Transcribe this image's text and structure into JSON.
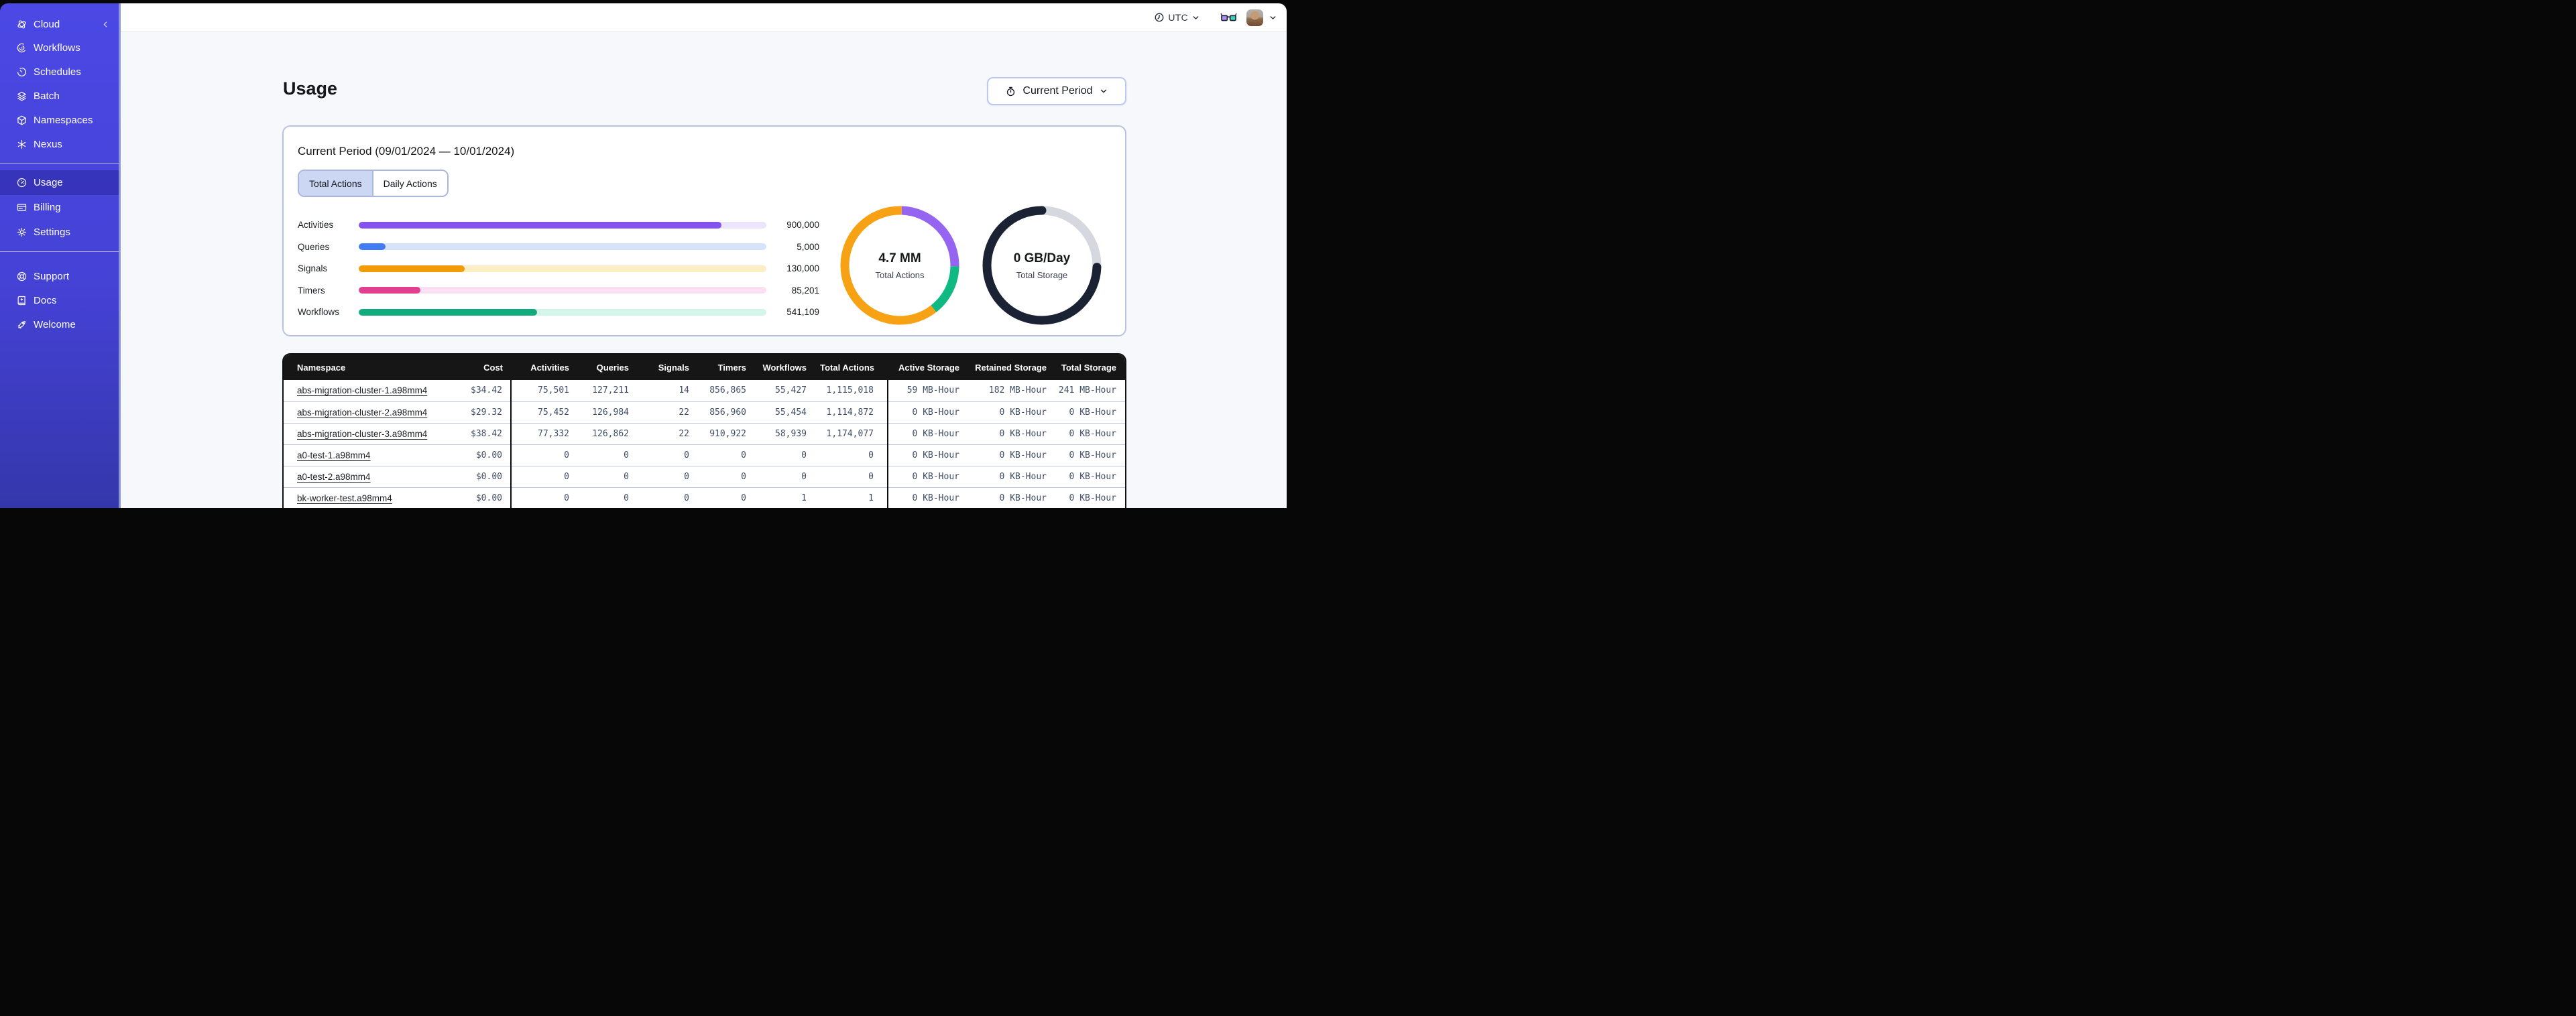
{
  "sidebar": {
    "brand": {
      "label": "Cloud"
    },
    "nav_main": [
      {
        "label": "Workflows"
      },
      {
        "label": "Schedules"
      },
      {
        "label": "Batch"
      },
      {
        "label": "Namespaces"
      },
      {
        "label": "Nexus"
      }
    ],
    "nav_account": [
      {
        "label": "Usage",
        "active": true
      },
      {
        "label": "Billing",
        "active": false
      },
      {
        "label": "Settings",
        "active": false
      }
    ],
    "nav_footer": [
      {
        "label": "Support"
      },
      {
        "label": "Docs"
      },
      {
        "label": "Welcome"
      }
    ]
  },
  "topbar": {
    "timezone": "UTC"
  },
  "page": {
    "title": "Usage",
    "period_selector_label": "Current Period"
  },
  "panel": {
    "title": "Current Period (09/01/2024 — 10/01/2024)",
    "tabs": [
      {
        "label": "Total Actions",
        "active": true
      },
      {
        "label": "Daily Actions",
        "active": false
      }
    ]
  },
  "chart_data": [
    {
      "type": "bar",
      "title": "Actions by type (current period)",
      "categories": [
        "Activities",
        "Queries",
        "Signals",
        "Timers",
        "Workflows"
      ],
      "values": [
        900000,
        5000,
        130000,
        85201,
        541109
      ],
      "value_labels": [
        "900,000",
        "5,000",
        "130,000",
        "85,201",
        "541,109"
      ],
      "fill_fractions": [
        0.89,
        0.065,
        0.26,
        0.152,
        0.438
      ],
      "bar_colors": [
        "#8453ef",
        "#417cf5",
        "#f19b06",
        "#e0408f",
        "#12ab7d"
      ],
      "track_colors": [
        "#ebe4fb",
        "#d7e3fb",
        "#fbeec5",
        "#fbdff2",
        "#d5f6e6"
      ],
      "legend_position": "none",
      "grid": false
    },
    {
      "type": "donut",
      "center_value": "4.7 MM",
      "center_label": "Total Actions",
      "rotate_deg": -88,
      "segments": [
        {
          "name": "purple-segment",
          "fraction": 0.247,
          "color": "#9565f2",
          "cap": "butt"
        },
        {
          "name": "green-segment",
          "fraction": 0.142,
          "color": "#10b981",
          "cap": "butt"
        },
        {
          "name": "orange-segment",
          "fraction": 0.611,
          "color": "#f6a214",
          "cap": "butt"
        }
      ]
    },
    {
      "type": "donut",
      "center_value": "0 GB/Day",
      "center_label": "Total Storage",
      "rotate_deg": -90,
      "segments": [
        {
          "name": "gray-segment",
          "fraction": 0.255,
          "color": "#d5d8de",
          "cap": "butt"
        },
        {
          "name": "dark-segment",
          "fraction": 0.745,
          "color": "#1b2233",
          "cap": "round"
        }
      ]
    }
  ],
  "table": {
    "columns": [
      "Namespace",
      "Cost",
      "Activities",
      "Queries",
      "Signals",
      "Timers",
      "Workflows",
      "Total Actions",
      "Active Storage",
      "Retained Storage",
      "Total Storage"
    ],
    "rows": [
      [
        "abs-migration-cluster-1.a98mm4",
        "$34.42",
        "75,501",
        "127,211",
        "14",
        "856,865",
        "55,427",
        "1,115,018",
        "59 MB-Hour",
        "182 MB-Hour",
        "241 MB-Hour"
      ],
      [
        "abs-migration-cluster-2.a98mm4",
        "$29.32",
        "75,452",
        "126,984",
        "22",
        "856,960",
        "55,454",
        "1,114,872",
        "0 KB-Hour",
        "0 KB-Hour",
        "0 KB-Hour"
      ],
      [
        "abs-migration-cluster-3.a98mm4",
        "$38.42",
        "77,332",
        "126,862",
        "22",
        "910,922",
        "58,939",
        "1,174,077",
        "0 KB-Hour",
        "0 KB-Hour",
        "0 KB-Hour"
      ],
      [
        "a0-test-1.a98mm4",
        "$0.00",
        "0",
        "0",
        "0",
        "0",
        "0",
        "0",
        "0 KB-Hour",
        "0 KB-Hour",
        "0 KB-Hour"
      ],
      [
        "a0-test-2.a98mm4",
        "$0.00",
        "0",
        "0",
        "0",
        "0",
        "0",
        "0",
        "0 KB-Hour",
        "0 KB-Hour",
        "0 KB-Hour"
      ],
      [
        "bk-worker-test.a98mm4",
        "$0.00",
        "0",
        "0",
        "0",
        "0",
        "1",
        "1",
        "0 KB-Hour",
        "0 KB-Hour",
        "0 KB-Hour"
      ]
    ]
  }
}
